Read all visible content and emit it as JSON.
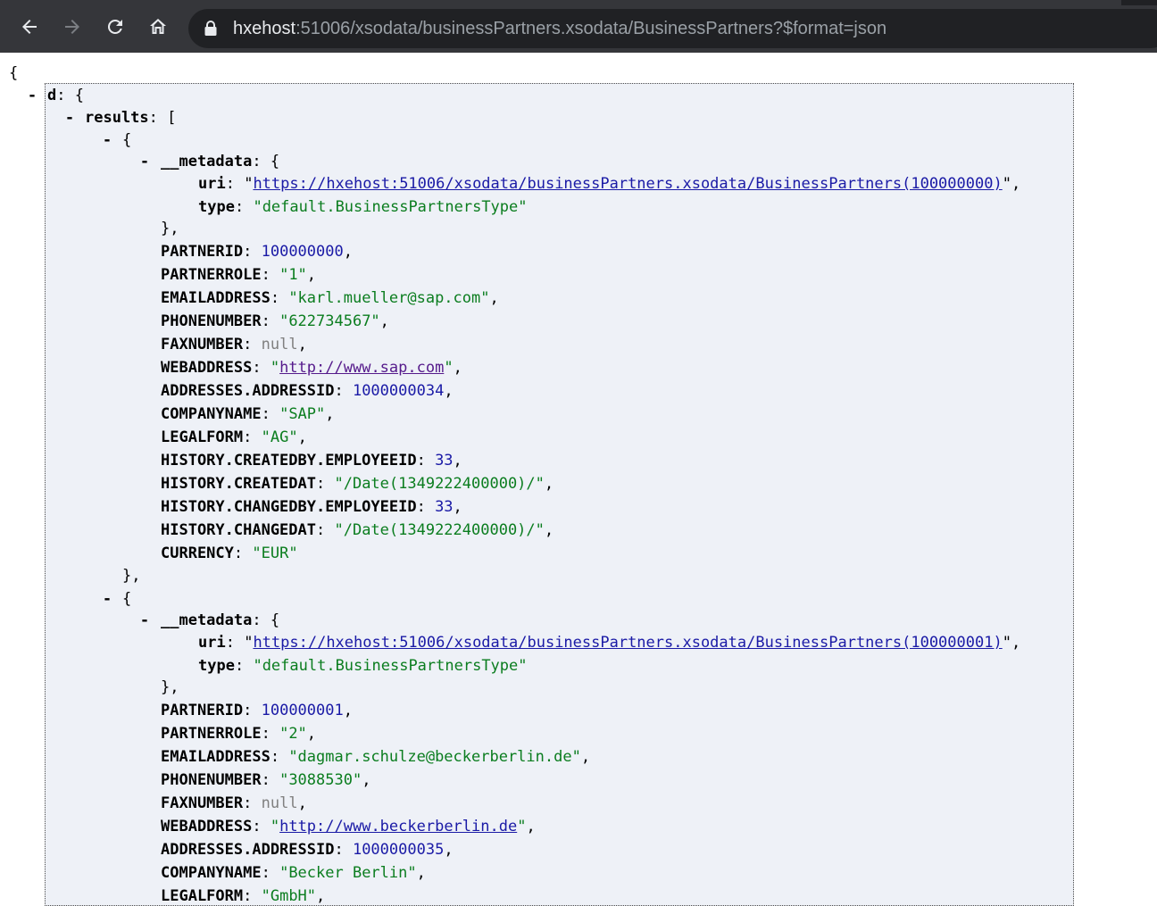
{
  "browser": {
    "url_host": "hxehost",
    "url_rest": ":51006/xsodata/businessPartners.xsodata/BusinessPartners?$format=json"
  },
  "json": {
    "open_brace": "{",
    "d_key": "d",
    "results_key": "results",
    "metadata_key": "__metadata",
    "uri_key": "uri",
    "type_key": "type",
    "records": [
      {
        "uri": "https://hxehost:51006/xsodata/businessPartners.xsodata/BusinessPartners(100000000)",
        "type": "default.BusinessPartnersType",
        "PARTNERID": "100000000",
        "PARTNERROLE": "\"1\"",
        "EMAILADDRESS": "\"karl.mueller@sap.com\"",
        "PHONENUMBER": "\"622734567\"",
        "FAXNUMBER": "null",
        "WEBADDRESS": "http://www.sap.com",
        "ADDRESSES_ADDRESSID": "1000000034",
        "COMPANYNAME": "\"SAP\"",
        "LEGALFORM": "\"AG\"",
        "HISTORY_CREATEDBY_EMPLOYEEID": "33",
        "HISTORY_CREATEDAT": "\"/Date(1349222400000)/\"",
        "HISTORY_CHANGEDBY_EMPLOYEEID": "33",
        "HISTORY_CHANGEDAT": "\"/Date(1349222400000)/\"",
        "CURRENCY": "\"EUR\""
      },
      {
        "uri": "https://hxehost:51006/xsodata/businessPartners.xsodata/BusinessPartners(100000001)",
        "type": "default.BusinessPartnersType",
        "PARTNERID": "100000001",
        "PARTNERROLE": "\"2\"",
        "EMAILADDRESS": "\"dagmar.schulze@beckerberlin.de\"",
        "PHONENUMBER": "\"3088530\"",
        "FAXNUMBER": "null",
        "WEBADDRESS": "http://www.beckerberlin.de",
        "ADDRESSES_ADDRESSID": "1000000035",
        "COMPANYNAME": "\"Becker Berlin\"",
        "LEGALFORM": "\"GmbH\""
      }
    ],
    "field_names": {
      "PARTNERID": "PARTNERID",
      "PARTNERROLE": "PARTNERROLE",
      "EMAILADDRESS": "EMAILADDRESS",
      "PHONENUMBER": "PHONENUMBER",
      "FAXNUMBER": "FAXNUMBER",
      "WEBADDRESS": "WEBADDRESS",
      "ADDRESSES_ADDRESSID": "ADDRESSES.ADDRESSID",
      "COMPANYNAME": "COMPANYNAME",
      "LEGALFORM": "LEGALFORM",
      "HISTORY_CREATEDBY_EMPLOYEEID": "HISTORY.CREATEDBY.EMPLOYEEID",
      "HISTORY_CREATEDAT": "HISTORY.CREATEDAT",
      "HISTORY_CHANGEDBY_EMPLOYEEID": "HISTORY.CHANGEDBY.EMPLOYEEID",
      "HISTORY_CHANGEDAT": "HISTORY.CHANGEDAT",
      "CURRENCY": "CURRENCY"
    },
    "collapse_glyph": "-"
  },
  "colors": {
    "toolbar": "#35363a",
    "omnibox": "#202124",
    "string": "#0b7d1f",
    "number": "#1a1aa6",
    "null": "#808080",
    "panel": "#eef1f7"
  },
  "icons": [
    "back-arrow-icon",
    "forward-arrow-icon",
    "reload-icon",
    "home-icon",
    "lock-icon"
  ]
}
